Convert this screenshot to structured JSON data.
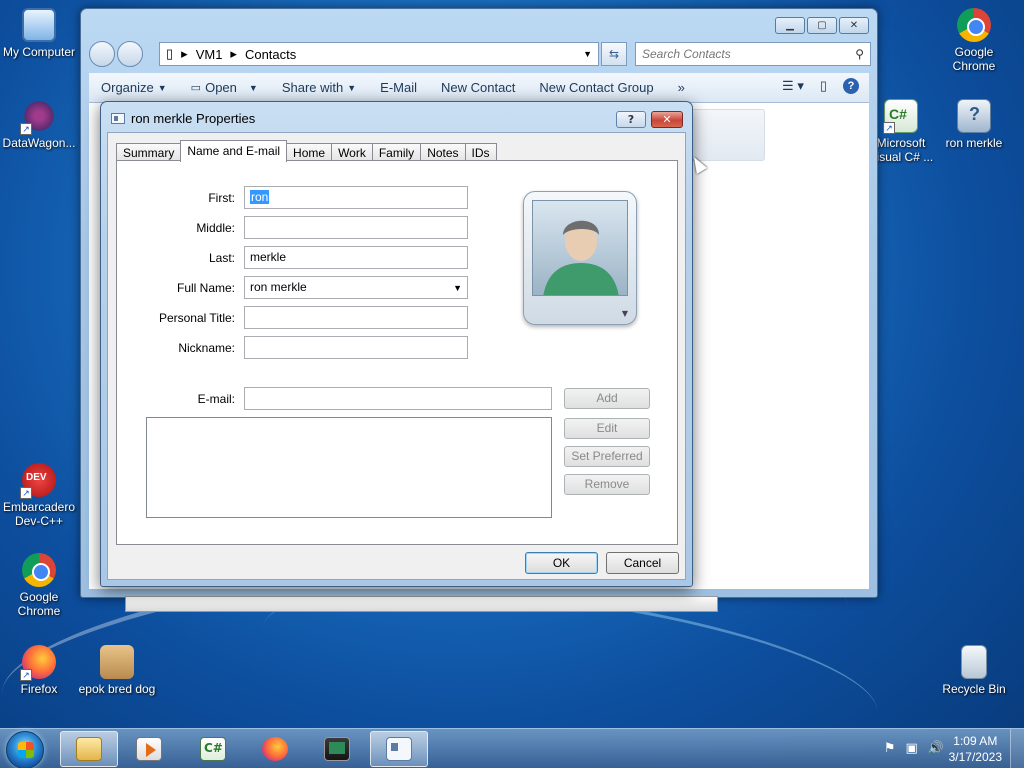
{
  "desktop": {
    "icons": [
      {
        "label": "My Computer",
        "icon": "computer-icon"
      },
      {
        "label": "DataWagon...",
        "icon": "datawagon-icon"
      },
      {
        "label": "Embarcadero Dev-C++",
        "icon": "devcpp-icon"
      },
      {
        "label": "Google Chrome",
        "icon": "chrome-icon"
      },
      {
        "label": "Firefox",
        "icon": "firefox-icon"
      },
      {
        "label": "epok bred dog",
        "icon": "bread-icon"
      },
      {
        "label": "Google Chrome",
        "icon": "chrome-icon"
      },
      {
        "label": "Microsoft Visual C# ...",
        "icon": "csharp-icon"
      },
      {
        "label": "ron merkle",
        "icon": "unknown-file-icon"
      },
      {
        "label": "Recycle Bin",
        "icon": "recycle-bin-icon"
      }
    ]
  },
  "explorer": {
    "breadcrumb": [
      "VM1",
      "Contacts"
    ],
    "search_placeholder": "Search Contacts",
    "toolbar": {
      "organize": "Organize",
      "open": "Open",
      "share_with": "Share with",
      "email": "E-Mail",
      "new_contact": "New Contact",
      "new_contact_group": "New Contact Group",
      "more": "»"
    }
  },
  "dialog": {
    "title": "ron merkle Properties",
    "help": "?",
    "tabs": [
      "Summary",
      "Name and E-mail",
      "Home",
      "Work",
      "Family",
      "Notes",
      "IDs"
    ],
    "active_tab": "Name and E-mail",
    "fields": {
      "first_label": "First:",
      "first_value": "ron",
      "middle_label": "Middle:",
      "middle_value": "",
      "last_label": "Last:",
      "last_value": "merkle",
      "full_name_label": "Full Name:",
      "full_name_value": "ron merkle",
      "personal_title_label": "Personal Title:",
      "personal_title_value": "",
      "nickname_label": "Nickname:",
      "nickname_value": "",
      "email_label": "E-mail:",
      "email_value": ""
    },
    "email_buttons": {
      "add": "Add",
      "edit": "Edit",
      "set_preferred": "Set Preferred",
      "remove": "Remove"
    },
    "ok": "OK",
    "cancel": "Cancel"
  },
  "taskbar": {
    "time": "1:09 AM",
    "date": "3/17/2023"
  },
  "colors": {
    "desktop_blue": "#1a6fc0",
    "selection": "#3399ff",
    "close_red": "#c9453a"
  }
}
